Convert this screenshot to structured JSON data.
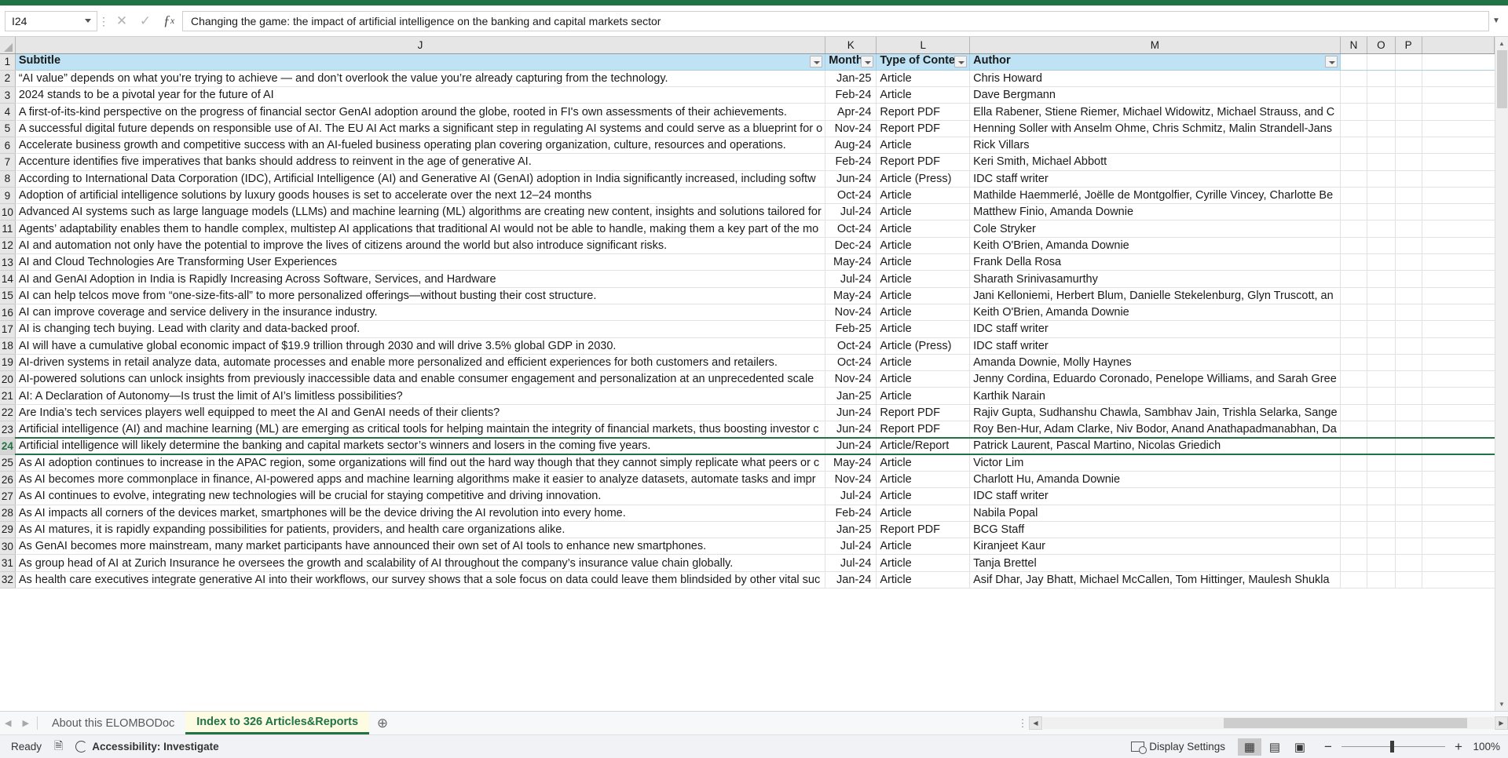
{
  "namebox": {
    "value": "I24"
  },
  "formula_bar": {
    "value": "Changing the game: the impact of artificial intelligence on the banking and capital markets sector",
    "cancel_icon": "close-icon",
    "confirm_icon": "check-icon",
    "function_icon": "fx-icon",
    "expand_icon": "chevron-down-icon"
  },
  "columns": {
    "letters": [
      "J",
      "K",
      "L",
      "M",
      "N",
      "O",
      "P"
    ]
  },
  "table_headers": {
    "subtitle": "Subtitle",
    "month": "Month P",
    "type": "Type of Content",
    "author": "Author"
  },
  "rows": [
    {
      "n": 2,
      "subtitle": "“AI value” depends on what you’re trying to achieve — and don’t overlook the value you’re already capturing from the technology.",
      "month": "Jan-25",
      "type": "Article",
      "author": "Chris Howard"
    },
    {
      "n": 3,
      "subtitle": "2024 stands to be a pivotal year for the future of AI",
      "month": "Feb-24",
      "type": "Article",
      "author": "Dave Bergmann"
    },
    {
      "n": 4,
      "subtitle": "A first-of-its-kind perspective on the progress of financial sector GenAI adoption around the globe, rooted in FI's own assessments of their achievements.",
      "month": "Apr-24",
      "type": "Report PDF",
      "author": "Ella Rabener, Stiene Riemer, Michael Widowitz, Michael Strauss, and C"
    },
    {
      "n": 5,
      "subtitle": "A successful digital future depends on responsible use of AI. The EU AI Act  marks a significant step in regulating AI systems and could serve as a blueprint  for o",
      "month": "Nov-24",
      "type": "Report PDF",
      "author": "Henning Soller with Anselm Ohme, Chris Schmitz, Malin Strandell-Jans"
    },
    {
      "n": 6,
      "subtitle": "Accelerate business growth and competitive success with an AI-fueled business operating plan covering organization, culture, resources and operations.",
      "month": "Aug-24",
      "type": "Article",
      "author": "Rick Villars"
    },
    {
      "n": 7,
      "subtitle": "Accenture identifies five imperatives that banks should address to reinvent in the age of generative AI.",
      "month": "Feb-24",
      "type": "Report PDF",
      "author": "Keri Smith, Michael Abbott"
    },
    {
      "n": 8,
      "subtitle": "According to International Data Corporation (IDC), Artificial Intelligence (AI) and Generative AI (GenAI) adoption in India significantly increased, including softw",
      "month": "Jun-24",
      "type": "Article (Press)",
      "author": "IDC staff writer"
    },
    {
      "n": 9,
      "subtitle": "Adoption of artificial intelligence solutions by luxury goods houses is set to accelerate over the next 12–24 months",
      "month": "Oct-24",
      "type": "Article",
      "author": "Mathilde Haemmerlé, Joëlle de Montgolfier, Cyrille Vincey, Charlotte Be"
    },
    {
      "n": 10,
      "subtitle": "Advanced AI systems such as large language models (LLMs) and machine learning (ML) algorithms are creating new content, insights and solutions tailored for",
      "month": "Jul-24",
      "type": "Article",
      "author": "Matthew Finio, Amanda Downie"
    },
    {
      "n": 11,
      "subtitle": "Agents’ adaptability enables them to handle complex, multistep AI applications that traditional AI would not be able to handle, making them a key part of the mo",
      "month": "Oct-24",
      "type": "Article",
      "author": "Cole Stryker"
    },
    {
      "n": 12,
      "subtitle": "AI and automation not only have the potential to improve the lives of citizens around the world but also introduce significant risks.",
      "month": "Dec-24",
      "type": "Article",
      "author": "Keith O'Brien, Amanda Downie"
    },
    {
      "n": 13,
      "subtitle": "AI and Cloud Technologies Are Transforming User Experiences",
      "month": "May-24",
      "type": "Article",
      "author": "Frank Della Rosa"
    },
    {
      "n": 14,
      "subtitle": "AI and GenAI Adoption in India is Rapidly Increasing Across Software, Services, and Hardware",
      "month": "Jul-24",
      "type": "Article",
      "author": "Sharath Srinivasamurthy"
    },
    {
      "n": 15,
      "subtitle": "AI can help telcos move from “one-size-fits-all” to more personalized offerings—without busting their cost structure.",
      "month": "May-24",
      "type": "Article",
      "author": "Jani Kelloniemi, Herbert Blum, Danielle Stekelenburg, Glyn Truscott, an"
    },
    {
      "n": 16,
      "subtitle": "AI can improve coverage and service delivery in the insurance industry.",
      "month": "Nov-24",
      "type": "Article",
      "author": "Keith O'Brien, Amanda Downie"
    },
    {
      "n": 17,
      "subtitle": "AI is changing tech buying. Lead with clarity and data-backed proof.",
      "month": "Feb-25",
      "type": "Article",
      "author": "IDC staff writer"
    },
    {
      "n": 18,
      "subtitle": "AI will have a cumulative global economic impact of $19.9 trillion through 2030 and will drive 3.5% global GDP in 2030.",
      "month": "Oct-24",
      "type": "Article (Press)",
      "author": "IDC staff writer"
    },
    {
      "n": 19,
      "subtitle": "AI-driven systems in retail analyze data, automate processes and enable more personalized and efficient experiences for both customers and retailers.",
      "month": "Oct-24",
      "type": "Article",
      "author": "Amanda Downie, Molly Haynes"
    },
    {
      "n": 20,
      "subtitle": "AI-powered solutions can unlock insights from previously inaccessible data and enable consumer engagement and personalization at an unprecedented scale",
      "month": "Nov-24",
      "type": "Article",
      "author": "Jenny Cordina, Eduardo Coronado, Penelope Williams, and Sarah Gree"
    },
    {
      "n": 21,
      "subtitle": "AI: A Declaration of Autonomy—Is trust the limit of AI’s limitless possibilities?",
      "month": "Jan-25",
      "type": "Article",
      "author": "Karthik Narain"
    },
    {
      "n": 22,
      "subtitle": "Are India’s tech services players well equipped to meet the AI and GenAI needs of their clients?",
      "month": "Jun-24",
      "type": "Report PDF",
      "author": "Rajiv Gupta,  Sudhanshu Chawla, Sambhav Jain, Trishla Selarka, Sange"
    },
    {
      "n": 23,
      "subtitle": "Artificial intelligence (AI) and machine learning (ML) are emerging as critical tools for helping maintain the integrity of financial markets, thus boosting investor c",
      "month": "Jun-24",
      "type": "Report PDF",
      "author": "Roy Ben-Hur, Adam Clarke, Niv Bodor, Anand Anathapadmanabhan, Da"
    },
    {
      "n": 24,
      "subtitle": "Artificial intelligence will likely determine the banking and capital markets sector’s winners and losers in the coming five years.",
      "month": "Jun-24",
      "type": "Article/Report",
      "author": "Patrick Laurent, Pascal Martino, Nicolas Griedich",
      "selected": true
    },
    {
      "n": 25,
      "subtitle": "As AI adoption continues to increase in the APAC region, some organizations will find out the hard way though that they cannot simply replicate what peers or c",
      "month": "May-24",
      "type": "Article",
      "author": "Victor Lim"
    },
    {
      "n": 26,
      "subtitle": "As AI becomes more commonplace in finance, AI-powered apps and machine learning algorithms make it easier to analyze datasets, automate tasks and impr",
      "month": "Nov-24",
      "type": "Article",
      "author": "Charlott Hu, Amanda Downie"
    },
    {
      "n": 27,
      "subtitle": "As AI continues to evolve, integrating new technologies will be crucial for staying competitive and driving innovation.",
      "month": "Jul-24",
      "type": "Article",
      "author": "IDC staff writer"
    },
    {
      "n": 28,
      "subtitle": "As AI impacts all corners of the devices market, smartphones will be the device driving the AI revolution into every home.",
      "month": "Feb-24",
      "type": "Article",
      "author": "Nabila Popal"
    },
    {
      "n": 29,
      "subtitle": "As AI matures, it is rapidly expanding possibilities for patients, providers, and health care organizations alike.",
      "month": "Jan-25",
      "type": "Report PDF",
      "author": "BCG Staff"
    },
    {
      "n": 30,
      "subtitle": "As GenAI becomes more mainstream, many market participants have announced their own set of AI tools to enhance new smartphones.",
      "month": "Jul-24",
      "type": "Article",
      "author": "Kiranjeet Kaur"
    },
    {
      "n": 31,
      "subtitle": "As group head of AI at Zurich Insurance he oversees the growth and scalability of AI throughout the company’s insurance value chain globally.",
      "month": "Jul-24",
      "type": "Article",
      "author": "Tanja Brettel"
    },
    {
      "n": 32,
      "subtitle": "As health care executives integrate generative AI into their workflows, our survey shows that a sole focus on data could leave them blindsided by other vital suc",
      "month": "Jan-24",
      "type": "Article",
      "author": "Asif Dhar, Jay Bhatt, Michael McCallen, Tom Hittinger, Maulesh Shukla"
    }
  ],
  "sheet_tabs": {
    "prev_icon": "chevron-left-icon",
    "next_icon": "chevron-right-icon",
    "tabs": [
      {
        "label": "About this ELOMBODoc",
        "active": false
      },
      {
        "label": "Index to 326 Articles&Reports",
        "active": true
      }
    ],
    "add_label": "+"
  },
  "status_bar": {
    "mode": "Ready",
    "macro_icon": "record-macro-icon",
    "accessibility_icon": "accessibility-icon",
    "accessibility": "Accessibility: Investigate",
    "display_settings_icon": "display-settings-icon",
    "display_settings": "Display Settings",
    "view_normal_icon": "normal-view-icon",
    "view_pagelayout_icon": "page-layout-view-icon",
    "view_pagebreak_icon": "page-break-view-icon",
    "zoom_out": "−",
    "zoom_in": "+",
    "zoom_level": "100%"
  },
  "colors": {
    "accent": "#217346",
    "header_fill": "#bfe3f5",
    "active_tab_fill": "#fdfce3"
  }
}
